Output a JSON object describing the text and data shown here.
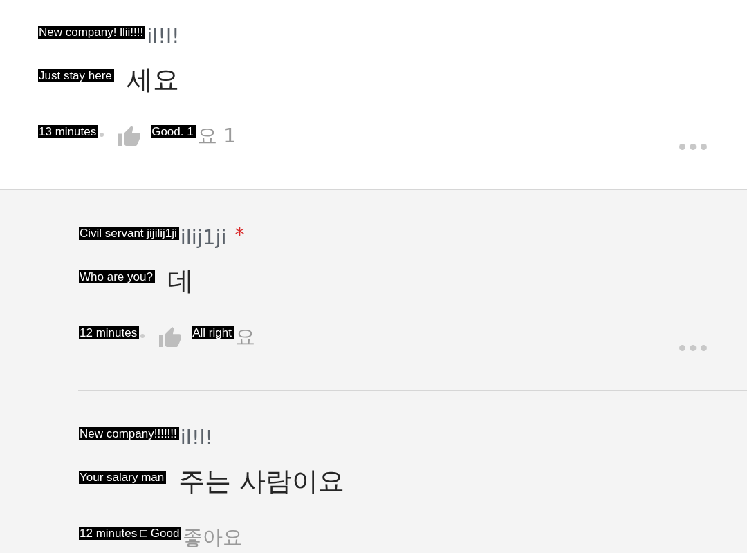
{
  "thread": [
    {
      "kind": "comment",
      "more_button": true,
      "author": [
        {
          "kind": "overlay",
          "text": "New company! llii!!!!"
        },
        {
          "kind": "name",
          "text": "il!l!"
        }
      ],
      "body": [
        {
          "kind": "overlay",
          "text": "Just stay here"
        },
        {
          "kind": "text",
          "text": "세요"
        }
      ],
      "meta": [
        {
          "kind": "overlay",
          "text": "13 minutes"
        },
        {
          "kind": "dot"
        },
        {
          "kind": "like-icon"
        },
        {
          "kind": "overlay",
          "text": "Good. 1"
        },
        {
          "kind": "text",
          "text": "요 1"
        }
      ]
    },
    {
      "kind": "reply",
      "more_button": true,
      "author": [
        {
          "kind": "overlay",
          "text": "Civil servant jijilij1ji"
        },
        {
          "kind": "name",
          "text": "ilij1ji"
        },
        {
          "kind": "asterisk",
          "text": "*"
        }
      ],
      "body": [
        {
          "kind": "overlay",
          "text": "Who are you?"
        },
        {
          "kind": "text",
          "text": "데"
        }
      ],
      "meta": [
        {
          "kind": "overlay",
          "text": "12 minutes"
        },
        {
          "kind": "dot"
        },
        {
          "kind": "like-icon"
        },
        {
          "kind": "overlay",
          "text": "All right"
        },
        {
          "kind": "text",
          "text": "요"
        }
      ]
    },
    {
      "kind": "reply",
      "more_button": false,
      "author": [
        {
          "kind": "overlay",
          "text": "New company!!!!!!!"
        },
        {
          "kind": "name",
          "text": "il!l!"
        }
      ],
      "body": [
        {
          "kind": "overlay",
          "text": "Your salary man"
        },
        {
          "kind": "text",
          "text": "주는 사람이요"
        }
      ],
      "meta": [
        {
          "kind": "overlay",
          "text": "12 minutes □ Good"
        },
        {
          "kind": "text",
          "text": "좋아요"
        }
      ]
    }
  ]
}
